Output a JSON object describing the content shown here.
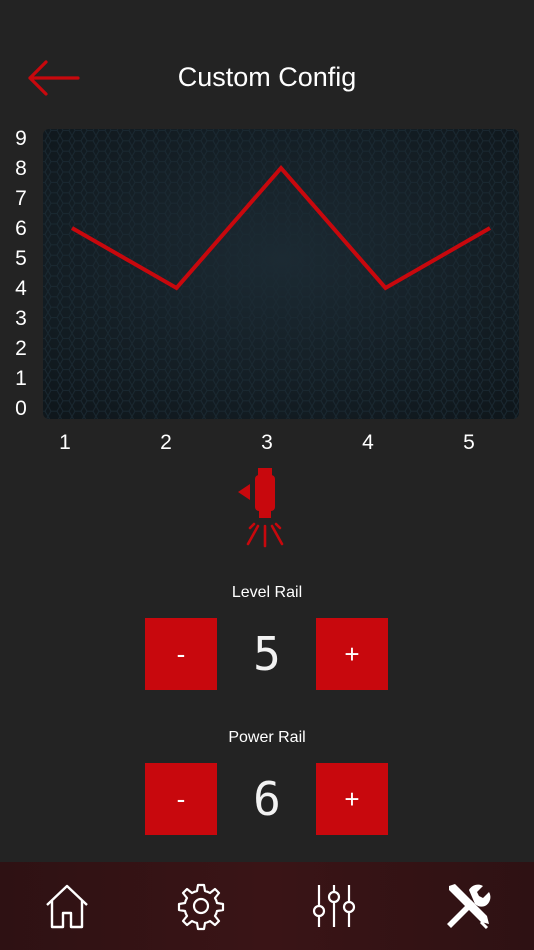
{
  "header": {
    "title": "Custom Config",
    "back_icon": "arrow-left-icon"
  },
  "chart_data": {
    "type": "line",
    "x": [
      1,
      2,
      3,
      4,
      5
    ],
    "series": [
      {
        "values": [
          6,
          4,
          8,
          4,
          6
        ]
      }
    ],
    "xticks": [
      "1",
      "2",
      "3",
      "4",
      "5"
    ],
    "yticks": [
      "0",
      "1",
      "2",
      "3",
      "4",
      "5",
      "6",
      "7",
      "8",
      "9"
    ],
    "ylim": [
      0,
      9
    ],
    "xlim": [
      1,
      5
    ],
    "line_color": "#c8080d",
    "background": "hex-mesh dark",
    "grid": false
  },
  "device_icon": "camera-light-icon",
  "level_rail": {
    "label": "Level Rail",
    "minus_label": "-",
    "value": "5",
    "plus_label": "+"
  },
  "power_rail": {
    "label": "Power Rail",
    "minus_label": "-",
    "value": "6",
    "plus_label": "+"
  },
  "tabbar": {
    "tabs": [
      {
        "icon": "home-icon"
      },
      {
        "icon": "gear-icon"
      },
      {
        "icon": "sliders-icon"
      },
      {
        "icon": "tools-icon"
      }
    ]
  },
  "colors": {
    "accent": "#c8080d",
    "background": "#232323",
    "tabbar": "#3a1416"
  }
}
